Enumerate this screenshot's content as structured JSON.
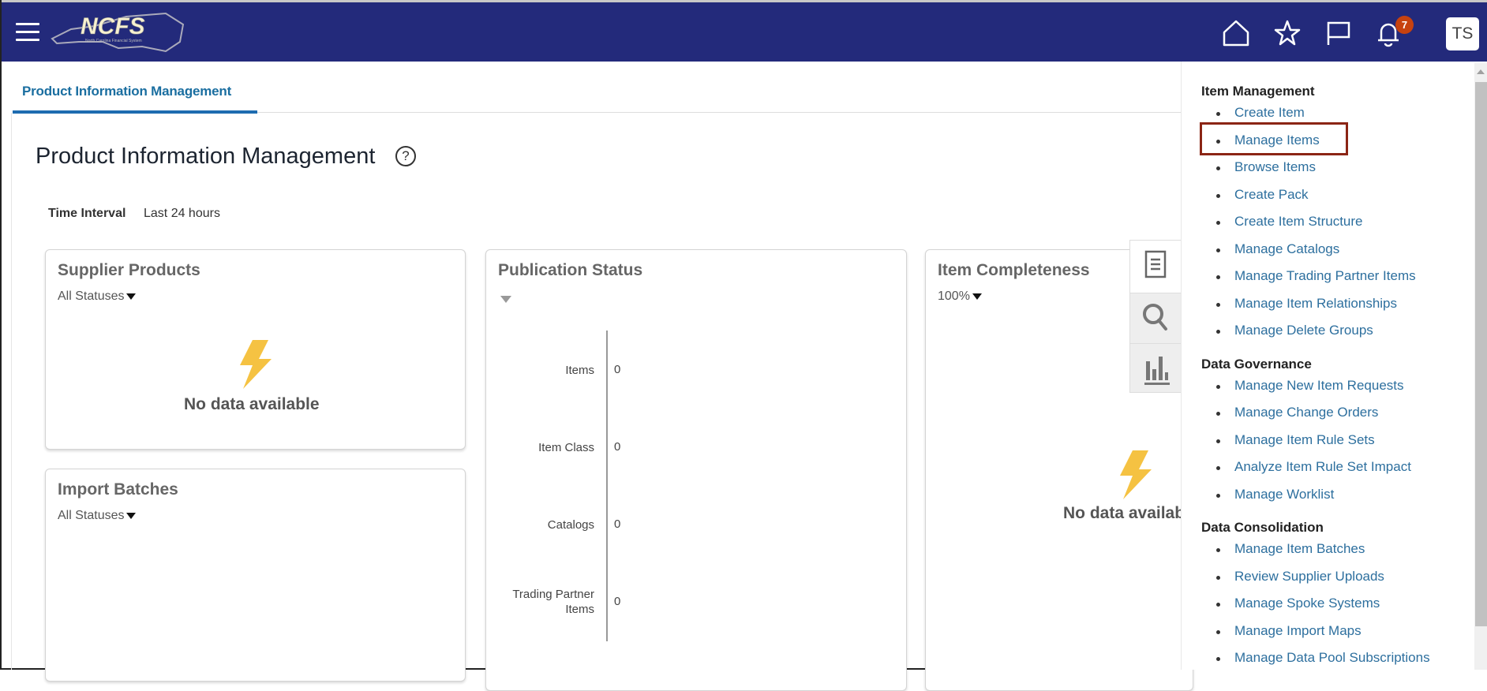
{
  "header": {
    "logo_text": "NCFS",
    "logo_subtitle": "North Carolina Financial System",
    "notification_count": "7",
    "user_initials": "TS",
    "icons": [
      "menu-icon",
      "home-icon",
      "star-icon",
      "flag-icon",
      "bell-icon"
    ]
  },
  "tabs": [
    {
      "label": "Product Information Management",
      "active": true
    }
  ],
  "page": {
    "title": "Product Information Management",
    "help": "?",
    "time_interval_label": "Time Interval",
    "time_interval_value": "Last 24 hours"
  },
  "cards": {
    "supplier_products": {
      "title": "Supplier Products",
      "filter": "All Statuses",
      "empty": "No data available"
    },
    "import_batches": {
      "title": "Import Batches",
      "filter": "All Statuses"
    },
    "publication_status": {
      "title": "Publication Status"
    },
    "item_completeness": {
      "title": "Item Completeness",
      "filter": "100%",
      "empty": "No data available"
    }
  },
  "chart_data": {
    "type": "bar",
    "title": "Publication Status",
    "orientation": "horizontal",
    "categories": [
      "Items",
      "Item Class",
      "Catalogs",
      "Trading Partner Items"
    ],
    "category_lines": [
      [
        "Items"
      ],
      [
        "Item Class"
      ],
      [
        "Catalogs"
      ],
      [
        "Trading Partner",
        "Items"
      ]
    ],
    "values": [
      0,
      0,
      0,
      0
    ],
    "value_labels": [
      "0",
      "0",
      "0",
      "0"
    ]
  },
  "side_tabs": [
    "tasks-icon",
    "search-icon",
    "analytics-icon"
  ],
  "panel": {
    "sections": [
      {
        "heading": "Item Management",
        "links": [
          "Create Item",
          "Manage Items",
          "Browse Items",
          "Create Pack",
          "Create Item Structure",
          "Manage Catalogs",
          "Manage Trading Partner Items",
          "Manage Item Relationships",
          "Manage Delete Groups"
        ]
      },
      {
        "heading": "Data Governance",
        "links": [
          "Manage New Item Requests",
          "Manage Change Orders",
          "Manage Item Rule Sets",
          "Analyze Item Rule Set Impact",
          "Manage Worklist"
        ]
      },
      {
        "heading": "Data Consolidation",
        "links": [
          "Manage Item Batches",
          "Review Supplier Uploads",
          "Manage Spoke Systems",
          "Manage Import Maps",
          "Manage Data Pool Subscriptions"
        ]
      }
    ],
    "highlighted": "Manage Items"
  },
  "colors": {
    "header": "#232a7b",
    "link": "#2d6f9e",
    "highlight": "#8b2515",
    "badge": "#c7420f",
    "bolt": "#f5c242"
  }
}
